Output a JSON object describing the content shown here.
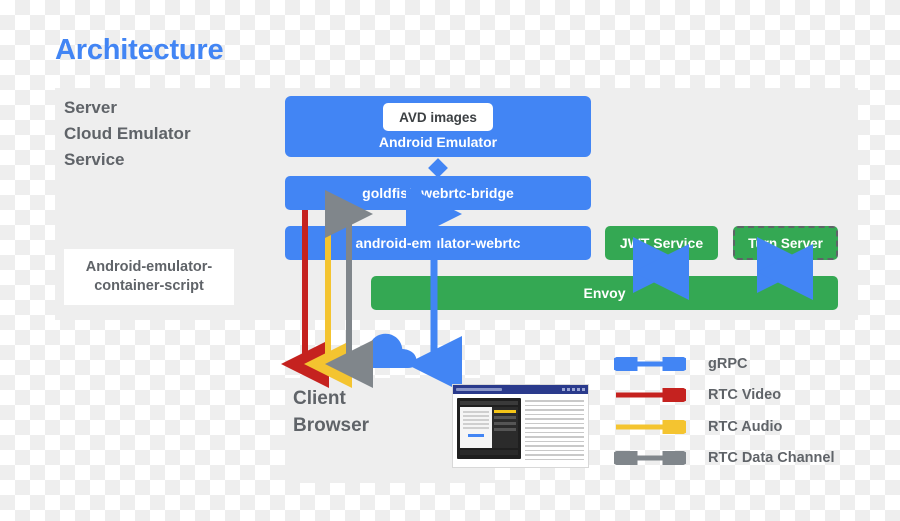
{
  "title": "Architecture",
  "colors": {
    "accent_blue": "#4285F4",
    "green": "#34A853",
    "red": "#C5221F",
    "yellow": "#F4C430",
    "gray": "#80868B",
    "panel_gray": "#EEEEEE",
    "text_gray": "#5F6368"
  },
  "panels": {
    "server": {
      "label_line1": "Server",
      "label_line2": "Cloud Emulator",
      "label_line3": "Service"
    },
    "container_script": {
      "label_line1": "Android-emulator-",
      "label_line2": "container-script"
    },
    "client": {
      "label_line1": "Client",
      "label_line2": "Browser"
    }
  },
  "boxes": {
    "avd_images": "AVD images",
    "android_emulator": "Android Emulator",
    "goldfish_bridge": "goldfish-webrtc-bridge",
    "android_emulator_webrtc": "android-emulator-webrtc",
    "jwt_service": "JWT Service",
    "turn_server": "Turn Server",
    "envoy": "Envoy"
  },
  "legend": {
    "items": [
      {
        "label": "gRPC",
        "color": "#4285F4",
        "style": "double"
      },
      {
        "label": "RTC Video",
        "color": "#C5221F",
        "style": "single"
      },
      {
        "label": "RTC Audio",
        "color": "#F4C430",
        "style": "single"
      },
      {
        "label": "RTC Data Channel",
        "color": "#80868B",
        "style": "double"
      }
    ]
  }
}
